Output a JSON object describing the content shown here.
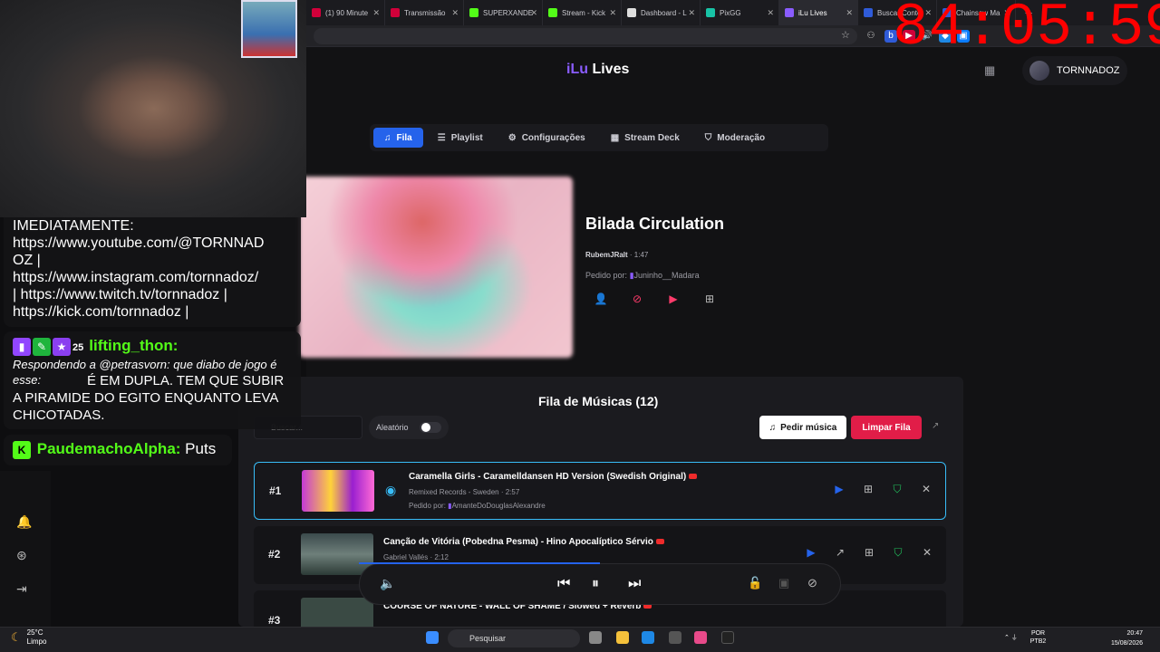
{
  "browser": {
    "tabs": [
      {
        "label": "(1) 90 Minute",
        "color": "#d1003a"
      },
      {
        "label": "Transmissão",
        "color": "#d1003a"
      },
      {
        "label": "SUPERXANDE",
        "color": "#53fc18"
      },
      {
        "label": "Stream - Kick",
        "color": "#53fc18"
      },
      {
        "label": "Dashboard - L",
        "color": "#dddddd"
      },
      {
        "label": "PixGG",
        "color": "#18c3a6"
      },
      {
        "label": "iLu Lives",
        "color": "#8a5cff"
      },
      {
        "label": "Buscar Conte",
        "color": "#2f5bd8"
      },
      {
        "label": "Chainsaw Ma",
        "color": "#2f5bd8"
      }
    ],
    "new_tab": "+"
  },
  "app": {
    "logo_prefix": "iLu",
    "logo_suffix": " Lives",
    "username": "TORNNADOZ"
  },
  "nav": {
    "tabs": [
      {
        "label": "Fila",
        "icon": "♫"
      },
      {
        "label": "Playlist",
        "icon": "☰"
      },
      {
        "label": "Configurações",
        "icon": "⚙"
      },
      {
        "label": "Stream Deck",
        "icon": "▦"
      },
      {
        "label": "Moderação",
        "icon": "⛉"
      }
    ]
  },
  "now_playing": {
    "title": "Bilada Circulation",
    "artist": "RubemJRalt",
    "duration": "1:47",
    "requested_by_label": "Pedido por:",
    "requested_by": "Juninho__Madara"
  },
  "queue": {
    "title": "Fila de Músicas (12)",
    "search_placeholder": "Buscar...",
    "shuffle_label": "Aleatório",
    "request_button": "Pedir música",
    "clear_button": "Limpar Fila",
    "items": [
      {
        "num": "#1",
        "title": "Caramella Girls - Caramelldansen HD Version (Swedish Original)",
        "channel": "Remixed Records - Sweden",
        "duration": "2:57",
        "requested_by_label": "Pedido por:",
        "requested_by": "AmanteDoDouglasAlexandre"
      },
      {
        "num": "#2",
        "title": "Canção de Vitória (Pobedna Pesma) - Hino Apocalíptico Sérvio",
        "channel": "Gabriel Vallés",
        "duration": "2:12"
      },
      {
        "num": "#3",
        "title": "COURSE OF NATURE - WALL OF SHAME / Slowed + Reverb"
      }
    ]
  },
  "player": {
    "progress": 0.5
  },
  "overlay": {
    "chat1_lines": [
      "IMEDIATAMENTE:",
      "https://www.youtube.com/@TORNNAD",
      "OZ |",
      "https://www.instagram.com/tornnadoz/",
      "| https://www.twitch.tv/tornnadoz |",
      "https://kick.com/tornnadoz |"
    ],
    "chat2_user": "lifting_thon:",
    "chat2_badge_num": "25",
    "chat2_reply": "Respondendo a @petrasvorn: que diabo de jogo é esse:",
    "chat2_text": "É EM DUPLA. TEM QUE SUBIR A PIRAMIDE DO EGITO ENQUANTO LEVA CHICOTADAS.",
    "chat3_user": "PaudemachoAlpha:",
    "chat3_text": "Puts",
    "timer": "84:05:59"
  },
  "taskbar": {
    "temp": "25°C",
    "condition": "Limpo",
    "search": "Pesquisar",
    "lang1": "POR",
    "lang2": "PTB2",
    "time": "20:47",
    "date": "15/08/2026"
  }
}
